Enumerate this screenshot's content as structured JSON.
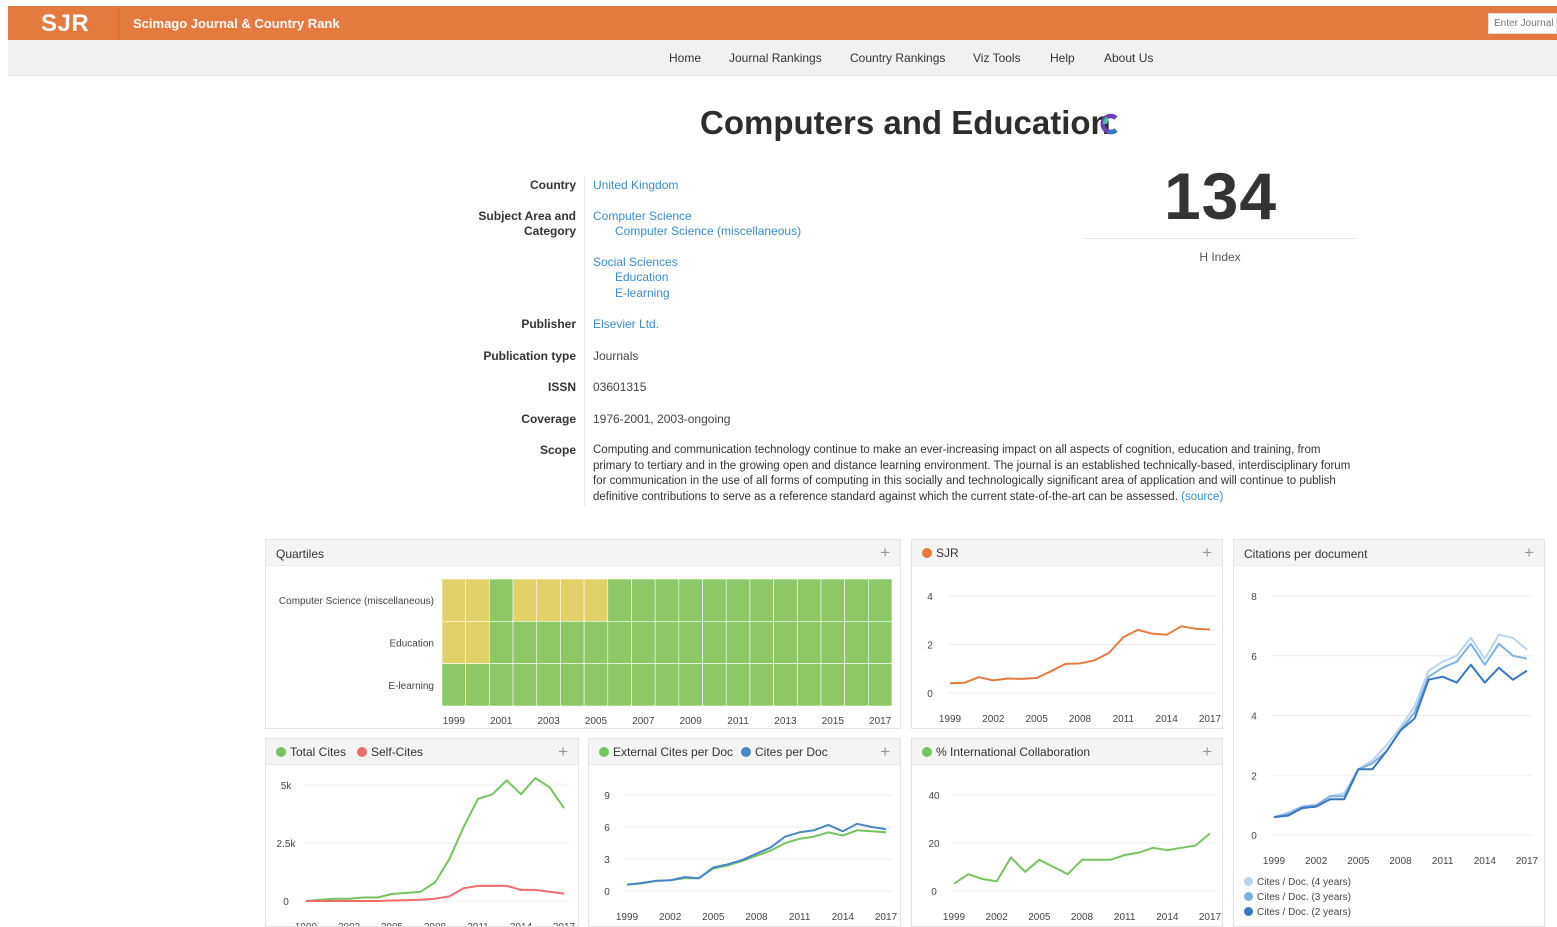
{
  "header": {
    "logo": "SJR",
    "site_title": "Scimago Journal & Country Rank",
    "search_placeholder": "Enter Journal"
  },
  "nav": [
    "Home",
    "Journal Rankings",
    "Country Rankings",
    "Viz Tools",
    "Help",
    "About Us"
  ],
  "journal": {
    "title": "Computers and Education",
    "labels": {
      "country": "Country",
      "subject_1": "Subject Area and",
      "subject_2": "Category",
      "publisher": "Publisher",
      "pubtype": "Publication type",
      "issn": "ISSN",
      "coverage": "Coverage",
      "scope": "Scope"
    },
    "country": "United Kingdom",
    "areas": [
      "Computer Science",
      "Social Sciences"
    ],
    "categories": [
      "Computer Science (miscellaneous)",
      "Education",
      "E-learning"
    ],
    "publisher": "Elsevier Ltd.",
    "publication_type": "Journals",
    "issn": "03601315",
    "coverage": "1976-2001, 2003-ongoing",
    "scope": "Computing and communication technology continue to make an ever-increasing impact on all aspects of cognition, education and training, from primary to tertiary and in the growing open and distance learning environment. The journal is an established technically-based, interdisciplinary forum for communication in the use of all forms of computing in this socially and technologically significant area of application and will continue to publish definitive contributions to serve as a reference standard against which the current state-of-the-art can be assessed.",
    "scope_link": "(source)",
    "h_index": "134",
    "h_index_label": "H Index"
  },
  "colors": {
    "brand": "#e57a40",
    "link": "#3a8cc9",
    "q1": "#8dc866",
    "q2": "#e0d168",
    "sjr": "#e57a40",
    "total_cites": "#77c361",
    "self_cites": "#f26b6b",
    "ext_cites": "#77c361",
    "cites_per_doc": "#4a86c8",
    "intl_collab": "#77c361",
    "cites4": "#b8d4ee",
    "cites3": "#7fb0e0",
    "cites2": "#3a76c4"
  },
  "panels": {
    "quartiles": "Quartiles",
    "sjr": "SJR",
    "cpd": "Citations per document",
    "total_cites": "Total Cites",
    "self_cites": "Self-Cites",
    "ext_cites": "External Cites per Doc",
    "cites_per_doc": "Cites per Doc",
    "intl": "% International Collaboration",
    "cpd_legend": [
      "Cites / Doc. (4 years)",
      "Cites / Doc. (3 years)",
      "Cites / Doc. (2 years)"
    ]
  },
  "chart_data": [
    {
      "type": "heatmap",
      "title": "Quartiles",
      "categories": [
        "Computer Science (miscellaneous)",
        "Education",
        "E-learning"
      ],
      "x": [
        1999,
        2000,
        2001,
        2002,
        2003,
        2004,
        2005,
        2006,
        2007,
        2008,
        2009,
        2010,
        2011,
        2012,
        2013,
        2014,
        2015,
        2016,
        2017
      ],
      "xticks": [
        "1999",
        "2001",
        "2003",
        "2005",
        "2007",
        "2009",
        "2011",
        "2013",
        "2015",
        "2017"
      ],
      "values": [
        [
          "Q2",
          "Q2",
          "Q1",
          "Q2",
          "Q2",
          "Q2",
          "Q2",
          "Q1",
          "Q1",
          "Q1",
          "Q1",
          "Q1",
          "Q1",
          "Q1",
          "Q1",
          "Q1",
          "Q1",
          "Q1",
          "Q1"
        ],
        [
          "Q2",
          "Q2",
          "Q1",
          "Q1",
          "Q1",
          "Q1",
          "Q1",
          "Q1",
          "Q1",
          "Q1",
          "Q1",
          "Q1",
          "Q1",
          "Q1",
          "Q1",
          "Q1",
          "Q1",
          "Q1",
          "Q1"
        ],
        [
          "Q1",
          "Q1",
          "Q1",
          "Q1",
          "Q1",
          "Q1",
          "Q1",
          "Q1",
          "Q1",
          "Q1",
          "Q1",
          "Q1",
          "Q1",
          "Q1",
          "Q1",
          "Q1",
          "Q1",
          "Q1",
          "Q1"
        ]
      ]
    },
    {
      "type": "line",
      "title": "SJR",
      "x": [
        1999,
        2000,
        2001,
        2002,
        2003,
        2004,
        2005,
        2006,
        2007,
        2008,
        2009,
        2010,
        2011,
        2012,
        2013,
        2014,
        2015,
        2016,
        2017
      ],
      "xticks": [
        "1999",
        "2002",
        "2005",
        "2008",
        "2011",
        "2014",
        "2017"
      ],
      "yticks": [
        "0",
        "2",
        "4"
      ],
      "ylim": [
        0,
        4
      ],
      "series": [
        {
          "name": "SJR",
          "values": [
            0.4,
            0.42,
            0.65,
            0.52,
            0.6,
            0.58,
            0.62,
            0.9,
            1.2,
            1.22,
            1.35,
            1.65,
            2.3,
            2.6,
            2.45,
            2.4,
            2.75,
            2.65,
            2.62
          ]
        }
      ]
    },
    {
      "type": "line",
      "title": "Citations per document",
      "x": [
        1999,
        2000,
        2001,
        2002,
        2003,
        2004,
        2005,
        2006,
        2007,
        2008,
        2009,
        2010,
        2011,
        2012,
        2013,
        2014,
        2015,
        2016,
        2017
      ],
      "xticks": [
        "1999",
        "2002",
        "2005",
        "2008",
        "2011",
        "2014",
        "2017"
      ],
      "yticks": [
        "0",
        "2",
        "4",
        "6",
        "8"
      ],
      "ylim": [
        0,
        8
      ],
      "series": [
        {
          "name": "Cites / Doc. (4 years)",
          "values": [
            0.6,
            0.75,
            0.95,
            1.0,
            1.3,
            1.4,
            2.2,
            2.5,
            3.0,
            3.6,
            4.3,
            5.5,
            5.8,
            6.0,
            6.6,
            5.9,
            6.7,
            6.6,
            6.2
          ]
        },
        {
          "name": "Cites / Doc. (3 years)",
          "values": [
            0.6,
            0.7,
            0.95,
            1.0,
            1.3,
            1.3,
            2.2,
            2.4,
            2.8,
            3.5,
            4.1,
            5.3,
            5.6,
            5.8,
            6.4,
            5.7,
            6.4,
            6.0,
            5.9
          ]
        },
        {
          "name": "Cites / Doc. (2 years)",
          "values": [
            0.6,
            0.65,
            0.9,
            0.95,
            1.2,
            1.2,
            2.2,
            2.2,
            2.8,
            3.5,
            3.9,
            5.2,
            5.3,
            5.1,
            5.7,
            5.1,
            5.6,
            5.2,
            5.5
          ]
        }
      ]
    },
    {
      "type": "line",
      "title": "Total Cites / Self-Cites",
      "x": [
        1999,
        2000,
        2001,
        2002,
        2003,
        2004,
        2005,
        2006,
        2007,
        2008,
        2009,
        2010,
        2011,
        2012,
        2013,
        2014,
        2015,
        2016,
        2017
      ],
      "xticks": [
        "1999",
        "2002",
        "2005",
        "2008",
        "2011",
        "2014",
        "2017"
      ],
      "yticks": [
        "0",
        "2.5k",
        "5k"
      ],
      "ylim": [
        0,
        5000
      ],
      "series": [
        {
          "name": "Total Cites",
          "values": [
            0,
            50,
            100,
            100,
            150,
            150,
            300,
            350,
            400,
            800,
            1800,
            3200,
            4400,
            4600,
            5200,
            4600,
            5300,
            4900,
            4000
          ]
        },
        {
          "name": "Self-Cites",
          "values": [
            0,
            0,
            0,
            0,
            0,
            0,
            20,
            30,
            50,
            100,
            200,
            550,
            650,
            650,
            650,
            480,
            480,
            400,
            320
          ]
        }
      ]
    },
    {
      "type": "line",
      "title": "External Cites per Doc / Cites per Doc",
      "x": [
        1999,
        2000,
        2001,
        2002,
        2003,
        2004,
        2005,
        2006,
        2007,
        2008,
        2009,
        2010,
        2011,
        2012,
        2013,
        2014,
        2015,
        2016,
        2017
      ],
      "xticks": [
        "1999",
        "2002",
        "2005",
        "2008",
        "2011",
        "2014",
        "2017"
      ],
      "yticks": [
        "0",
        "3",
        "6",
        "9"
      ],
      "ylim": [
        0,
        9
      ],
      "series": [
        {
          "name": "External Cites per Doc",
          "values": [
            0.6,
            0.7,
            0.95,
            1.0,
            1.2,
            1.2,
            2.1,
            2.4,
            2.8,
            3.3,
            3.8,
            4.5,
            4.9,
            5.1,
            5.5,
            5.2,
            5.7,
            5.6,
            5.5
          ]
        },
        {
          "name": "Cites per Doc",
          "values": [
            0.6,
            0.75,
            0.95,
            1.0,
            1.3,
            1.2,
            2.2,
            2.5,
            2.9,
            3.5,
            4.1,
            5.1,
            5.5,
            5.7,
            6.2,
            5.6,
            6.3,
            6.0,
            5.8
          ]
        }
      ]
    },
    {
      "type": "line",
      "title": "% International Collaboration",
      "x": [
        1999,
        2000,
        2001,
        2002,
        2003,
        2004,
        2005,
        2006,
        2007,
        2008,
        2009,
        2010,
        2011,
        2012,
        2013,
        2014,
        2015,
        2016,
        2017
      ],
      "xticks": [
        "1999",
        "2002",
        "2005",
        "2008",
        "2011",
        "2014",
        "2017"
      ],
      "yticks": [
        "0",
        "20",
        "40"
      ],
      "ylim": [
        0,
        40
      ],
      "series": [
        {
          "name": "% International Collaboration",
          "values": [
            3,
            7,
            5,
            4,
            14,
            8,
            13,
            10,
            7,
            13,
            13,
            13,
            15,
            16,
            18,
            17,
            18,
            19,
            24
          ]
        }
      ]
    }
  ]
}
